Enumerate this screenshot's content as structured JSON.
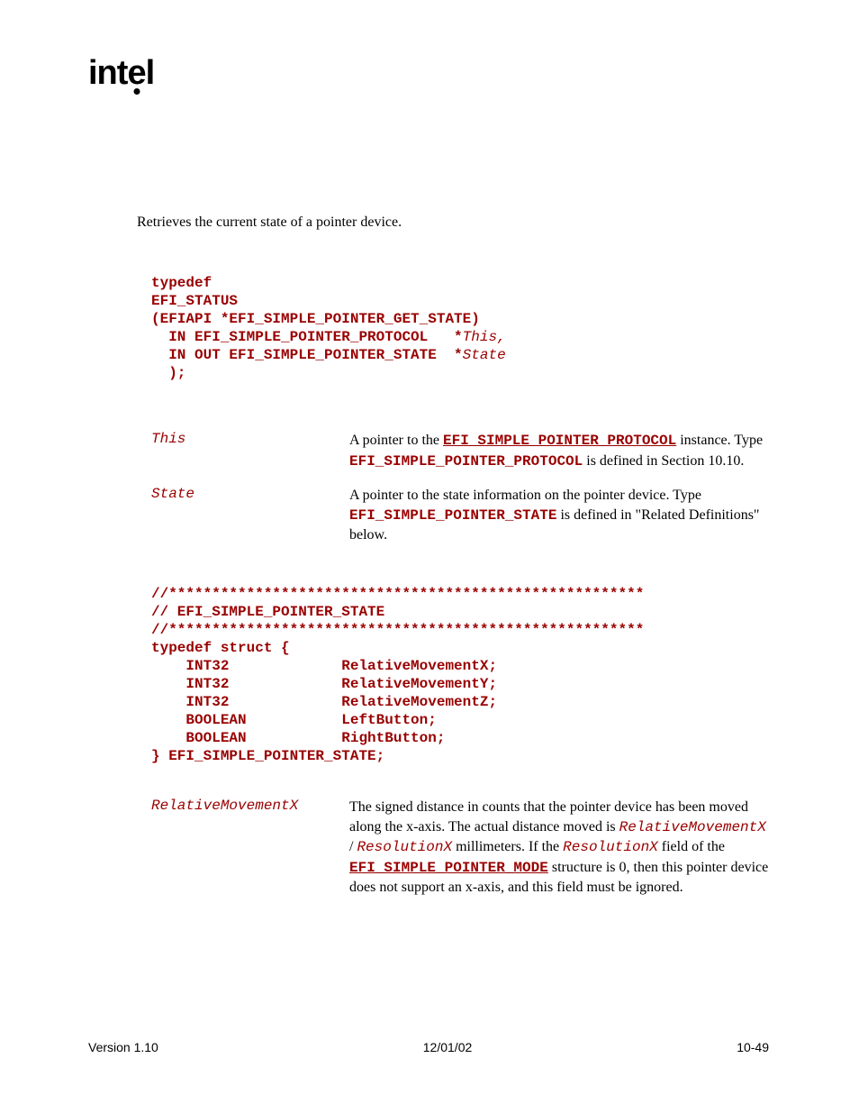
{
  "logo": "intel",
  "summary": "Retrieves the current state of a pointer device.",
  "code1": {
    "l1": "typedef",
    "l2": "EFI_STATUS",
    "l3": "(EFIAPI *EFI_SIMPLE_POINTER_GET_STATE)",
    "l4a": "  IN EFI_SIMPLE_POINTER_PROTOCOL   *",
    "l4b": "This,",
    "l5a": "  IN OUT EFI_SIMPLE_POINTER_STATE  *",
    "l5b": "State",
    "l6": "  );"
  },
  "params": {
    "this": {
      "name": "This",
      "d1": "A pointer to the ",
      "d2": "EFI_SIMPLE_POINTER_PROTOCOL",
      "d3": " instance.  Type ",
      "d4": "EFI_SIMPLE_POINTER_PROTOCOL",
      "d5": " is defined in Section 10.10."
    },
    "state": {
      "name": "State",
      "d1": "A pointer to the state information on the pointer device.  Type ",
      "d2": "EFI_SIMPLE_POINTER_STATE",
      "d3": " is defined in \"Related Definitions\" below."
    }
  },
  "code2": {
    "l1": "//*******************************************************",
    "l2": "// EFI_SIMPLE_POINTER_STATE",
    "l3": "//*******************************************************",
    "l4": "typedef struct {",
    "l5": "    INT32             RelativeMovementX;",
    "l6": "    INT32             RelativeMovementY;",
    "l7": "    INT32             RelativeMovementZ;",
    "l8": "    BOOLEAN           LeftButton;",
    "l9": "    BOOLEAN           RightButton;",
    "l10": "} EFI_SIMPLE_POINTER_STATE;"
  },
  "relx": {
    "name": "RelativeMovementX",
    "d1": "The signed distance in counts that the pointer device has been moved along the x-axis.  The actual distance moved is ",
    "d2": "RelativeMovementX",
    "d3": " / ",
    "d4": "ResolutionX",
    "d5": " millimeters.  If the ",
    "d6": "ResolutionX",
    "d7": " field of the ",
    "d8": "EFI_SIMPLE_POINTER_MODE",
    "d9": " structure is 0, then this pointer device does not support an x-axis, and this field must be ignored."
  },
  "footer": {
    "left": "Version 1.10",
    "center": "12/01/02",
    "right": "10-49"
  }
}
